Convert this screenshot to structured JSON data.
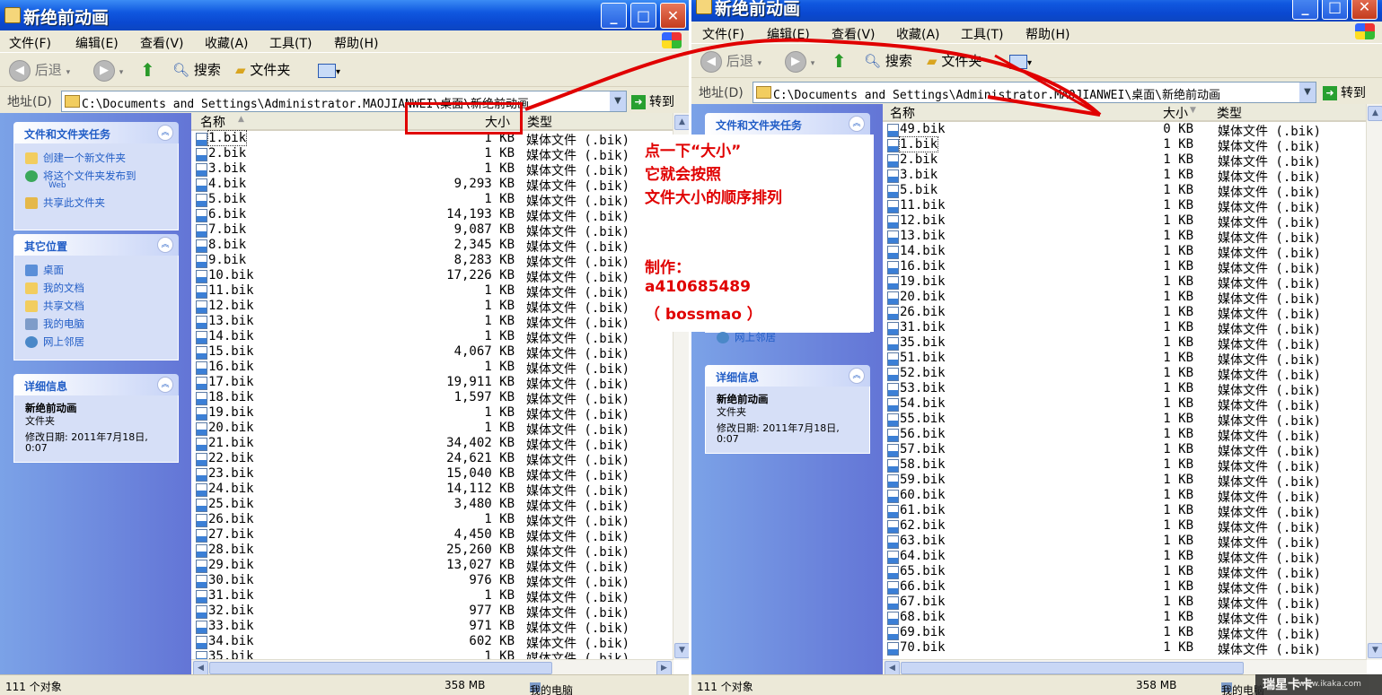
{
  "window_title": "新绝前动画",
  "menu": [
    "文件(F)",
    "编辑(E)",
    "查看(V)",
    "收藏(A)",
    "工具(T)",
    "帮助(H)"
  ],
  "toolbar": {
    "back": "后退",
    "search": "搜索",
    "folders": "文件夹"
  },
  "address": {
    "label": "地址(D)",
    "path": "C:\\Documents and Settings\\Administrator.MAOJIANWEI\\桌面\\新绝前动画",
    "go": "转到"
  },
  "tasks": {
    "title": "文件和文件夹任务",
    "items": [
      "创建一个新文件夹",
      "将这个文件夹发布到",
      "Web",
      "共享此文件夹"
    ]
  },
  "other_places": {
    "title": "其它位置",
    "items": [
      "桌面",
      "我的文档",
      "共享文档",
      "我的电脑",
      "网上邻居"
    ]
  },
  "details": {
    "title": "详细信息",
    "name": "新绝前动画",
    "kind": "文件夹",
    "modified_1": "修改日期: 2011年7月18日,",
    "modified_2": "0:07"
  },
  "columns": {
    "name": "名称",
    "size": "大小",
    "type": "类型"
  },
  "type_text": "媒体文件 (.bik)",
  "left_files": [
    {
      "name": "1.bik",
      "size": "1 KB"
    },
    {
      "name": "2.bik",
      "size": "1 KB"
    },
    {
      "name": "3.bik",
      "size": "1 KB"
    },
    {
      "name": "4.bik",
      "size": "9,293 KB"
    },
    {
      "name": "5.bik",
      "size": "1 KB"
    },
    {
      "name": "6.bik",
      "size": "14,193 KB"
    },
    {
      "name": "7.bik",
      "size": "9,087 KB"
    },
    {
      "name": "8.bik",
      "size": "2,345 KB"
    },
    {
      "name": "9.bik",
      "size": "8,283 KB"
    },
    {
      "name": "10.bik",
      "size": "17,226 KB"
    },
    {
      "name": "11.bik",
      "size": "1 KB"
    },
    {
      "name": "12.bik",
      "size": "1 KB"
    },
    {
      "name": "13.bik",
      "size": "1 KB"
    },
    {
      "name": "14.bik",
      "size": "1 KB"
    },
    {
      "name": "15.bik",
      "size": "4,067 KB"
    },
    {
      "name": "16.bik",
      "size": "1 KB"
    },
    {
      "name": "17.bik",
      "size": "19,911 KB"
    },
    {
      "name": "18.bik",
      "size": "1,597 KB"
    },
    {
      "name": "19.bik",
      "size": "1 KB"
    },
    {
      "name": "20.bik",
      "size": "1 KB"
    },
    {
      "name": "21.bik",
      "size": "34,402 KB"
    },
    {
      "name": "22.bik",
      "size": "24,621 KB"
    },
    {
      "name": "23.bik",
      "size": "15,040 KB"
    },
    {
      "name": "24.bik",
      "size": "14,112 KB"
    },
    {
      "name": "25.bik",
      "size": "3,480 KB"
    },
    {
      "name": "26.bik",
      "size": "1 KB"
    },
    {
      "name": "27.bik",
      "size": "4,450 KB"
    },
    {
      "name": "28.bik",
      "size": "25,260 KB"
    },
    {
      "name": "29.bik",
      "size": "13,027 KB"
    },
    {
      "name": "30.bik",
      "size": "976 KB"
    },
    {
      "name": "31.bik",
      "size": "1 KB"
    },
    {
      "name": "32.bik",
      "size": "977 KB"
    },
    {
      "name": "33.bik",
      "size": "971 KB"
    },
    {
      "name": "34.bik",
      "size": "602 KB"
    },
    {
      "name": "35.bik",
      "size": "1 KB"
    }
  ],
  "right_files": [
    {
      "name": "49.bik",
      "size": "0 KB"
    },
    {
      "name": "1.bik",
      "size": "1 KB"
    },
    {
      "name": "2.bik",
      "size": "1 KB"
    },
    {
      "name": "3.bik",
      "size": "1 KB"
    },
    {
      "name": "5.bik",
      "size": "1 KB"
    },
    {
      "name": "11.bik",
      "size": "1 KB"
    },
    {
      "name": "12.bik",
      "size": "1 KB"
    },
    {
      "name": "13.bik",
      "size": "1 KB"
    },
    {
      "name": "14.bik",
      "size": "1 KB"
    },
    {
      "name": "16.bik",
      "size": "1 KB"
    },
    {
      "name": "19.bik",
      "size": "1 KB"
    },
    {
      "name": "20.bik",
      "size": "1 KB"
    },
    {
      "name": "26.bik",
      "size": "1 KB"
    },
    {
      "name": "31.bik",
      "size": "1 KB"
    },
    {
      "name": "35.bik",
      "size": "1 KB"
    },
    {
      "name": "51.bik",
      "size": "1 KB"
    },
    {
      "name": "52.bik",
      "size": "1 KB"
    },
    {
      "name": "53.bik",
      "size": "1 KB"
    },
    {
      "name": "54.bik",
      "size": "1 KB"
    },
    {
      "name": "55.bik",
      "size": "1 KB"
    },
    {
      "name": "56.bik",
      "size": "1 KB"
    },
    {
      "name": "57.bik",
      "size": "1 KB"
    },
    {
      "name": "58.bik",
      "size": "1 KB"
    },
    {
      "name": "59.bik",
      "size": "1 KB"
    },
    {
      "name": "60.bik",
      "size": "1 KB"
    },
    {
      "name": "61.bik",
      "size": "1 KB"
    },
    {
      "name": "62.bik",
      "size": "1 KB"
    },
    {
      "name": "63.bik",
      "size": "1 KB"
    },
    {
      "name": "64.bik",
      "size": "1 KB"
    },
    {
      "name": "65.bik",
      "size": "1 KB"
    },
    {
      "name": "66.bik",
      "size": "1 KB"
    },
    {
      "name": "67.bik",
      "size": "1 KB"
    },
    {
      "name": "68.bik",
      "size": "1 KB"
    },
    {
      "name": "69.bik",
      "size": "1 KB"
    },
    {
      "name": "70.bik",
      "size": "1 KB"
    }
  ],
  "status": {
    "count": "111 个对象",
    "size": "358 MB",
    "location": "我的电脑"
  },
  "annotation": {
    "line1": "点一下“大小”",
    "line2": "它就会按照",
    "line3": "文件大小的顺序排列",
    "line4": "制作：",
    "line5": "a410685489",
    "line6": "（ bossmao ）"
  },
  "watermark": {
    "brand": "瑞星卡卡",
    "url": "www.ikaka.com"
  },
  "colors": {
    "annotation_red": "#e00000",
    "xp_blue": "#0a3fd6",
    "task_link": "#215dc6"
  }
}
